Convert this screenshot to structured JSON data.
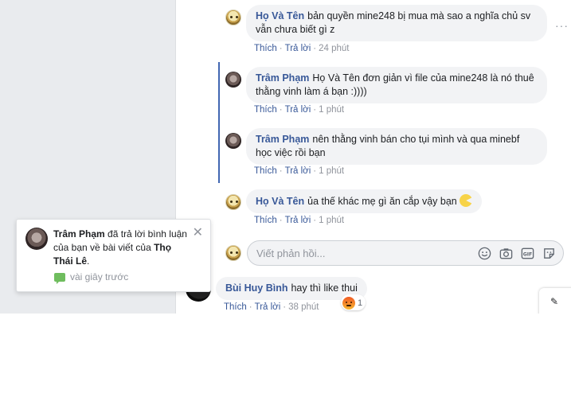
{
  "comments": [
    {
      "author": "Họ Và Tên",
      "text": "bản quyền mine248 bị mua mà sao a nghĩa chủ sv vẫn chưa biết gì z",
      "like": "Thích",
      "reply": "Trả lời",
      "time": "24 phút"
    },
    {
      "author": "Trâm Phạm",
      "text": "Họ Và Tên đơn giản vì file của mine248 là nó thuê thằng vinh làm á bạn :))))",
      "like": "Thích",
      "reply": "Trả lời",
      "time": "1 phút"
    },
    {
      "author": "Trâm Phạm",
      "text": "nên thằng vinh bán cho tụi mình và qua minebf học việc rồi bạn",
      "like": "Thích",
      "reply": "Trả lời",
      "time": "1 phút"
    },
    {
      "author": "Họ Và Tên",
      "text": "ủa thế khác mẹ gì ăn cắp vậy bạn",
      "emoji": "pacman-emoji",
      "like": "Thích",
      "reply": "Trả lời",
      "time": "1 phút"
    },
    {
      "author": "Bùi Huy Bình",
      "text": "hay thì like thui",
      "like": "Thích",
      "reply": "Trả lời",
      "time": "38 phút",
      "reaction": "angry-icon",
      "reaction_count": "1"
    }
  ],
  "reply_box": {
    "placeholder": "Viết phản hồi...",
    "icons": [
      "emoji-icon",
      "camera-icon",
      "gif-icon",
      "sticker-icon"
    ]
  },
  "notification": {
    "actor": "Trâm Phạm",
    "message": "đã trả lời bình luận của bạn về bài viết của",
    "target": "Thọ Thái Lê",
    "end": ".",
    "time": "vài giây trước"
  },
  "more_options": "···",
  "colors": {
    "link": "#385898",
    "bubble": "#f2f3f5",
    "thread_line": "#4267b2",
    "sidebar_bg": "#e9ebee"
  }
}
